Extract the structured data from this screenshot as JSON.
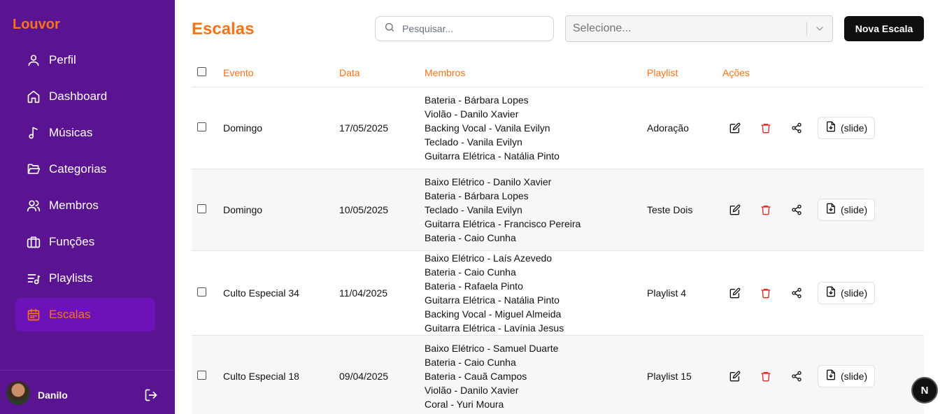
{
  "app": {
    "brand": "Louvor"
  },
  "sidebar": {
    "items": [
      {
        "label": "Perfil",
        "icon": "user-icon"
      },
      {
        "label": "Dashboard",
        "icon": "home-icon"
      },
      {
        "label": "Músicas",
        "icon": "music-note-icon"
      },
      {
        "label": "Categorias",
        "icon": "folder-open-icon"
      },
      {
        "label": "Membros",
        "icon": "users-icon"
      },
      {
        "label": "Funções",
        "icon": "briefcase-icon"
      },
      {
        "label": "Playlists",
        "icon": "list-music-icon"
      },
      {
        "label": "Escalas",
        "icon": "calendar-icon",
        "active": true
      }
    ],
    "user": {
      "name": "Danilo"
    }
  },
  "main": {
    "title": "Escalas",
    "search": {
      "placeholder": "Pesquisar..."
    },
    "select": {
      "value": "Selecione..."
    },
    "new_button": "Nova Escala"
  },
  "table": {
    "headers": {
      "event": "Evento",
      "date": "Data",
      "members": "Membros",
      "playlist": "Playlist",
      "actions": "Ações"
    },
    "slide_label": "(slide)",
    "rows": [
      {
        "event": "Domingo",
        "date": "17/05/2025",
        "members": [
          "Bateria - Bárbara Lopes",
          "Violão - Danilo Xavier",
          "Backing Vocal - Vanila Evilyn",
          "Teclado - Vanila Evilyn",
          "Guitarra Elétrica - Natália Pinto"
        ],
        "playlist": "Adoração"
      },
      {
        "event": "Domingo",
        "date": "10/05/2025",
        "members": [
          "Baixo Elétrico - Danilo Xavier",
          "Bateria - Bárbara Lopes",
          "Teclado - Vanila Evilyn",
          "Guitarra Elétrica - Francisco Pereira",
          "Bateria - Caio Cunha"
        ],
        "playlist": "Teste Dois"
      },
      {
        "event": "Culto Especial 34",
        "date": "11/04/2025",
        "members": [
          "Baixo Elétrico - Laís Azevedo",
          "Bateria - Caio Cunha",
          "Bateria - Rafaela Pinto",
          "Guitarra Elétrica - Natália Pinto",
          "Backing Vocal - Miguel Almeida",
          "Guitarra Elétrica - Lavínia Jesus"
        ],
        "playlist": "Playlist 4"
      },
      {
        "event": "Culto Especial 18",
        "date": "09/04/2025",
        "members": [
          "Baixo Elétrico - Samuel Duarte",
          "Bateria - Caio Cunha",
          "Bateria - Cauã Campos",
          "Violão - Danilo Xavier",
          "Coral - Yuri Moura"
        ],
        "playlist": "Playlist 15"
      }
    ]
  },
  "badge": {
    "letter": "N"
  },
  "colors": {
    "sidebar": "#5b1491",
    "accent": "#f97316",
    "active_item": "#6d12b8",
    "delete": "#dc2626"
  }
}
